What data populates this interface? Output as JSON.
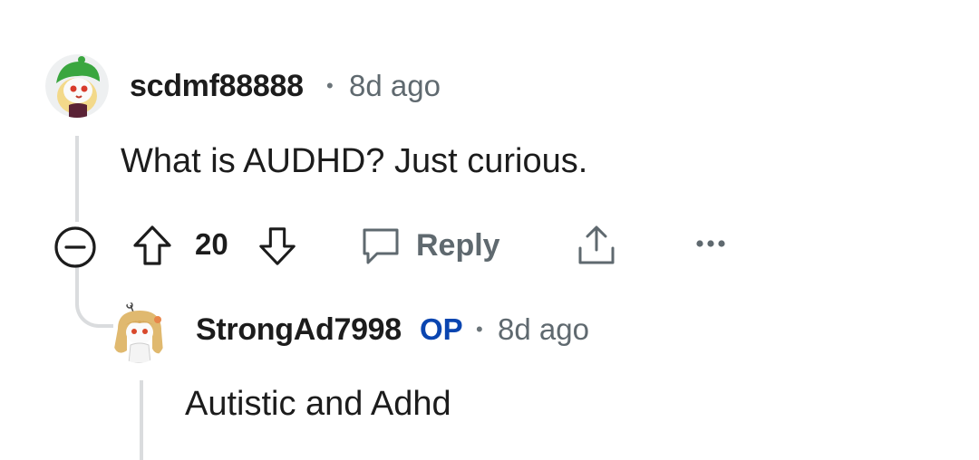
{
  "comment": {
    "username": "scdmf88888",
    "separator": "•",
    "time": "8d ago",
    "body": "What is AUDHD? Just curious.",
    "actions": {
      "score": "20",
      "reply_label": "Reply",
      "icons": [
        "collapse-icon",
        "upvote-icon",
        "downvote-icon",
        "reply-bubble-icon",
        "share-icon",
        "more-icon"
      ]
    }
  },
  "reply": {
    "username": "StrongAd7998",
    "op_badge": "OP",
    "separator": "•",
    "time": "8d ago",
    "body": "Autistic and Adhd"
  },
  "colors": {
    "op_badge": "#0a45b0",
    "meta_text": "#5f696f",
    "thread_line": "#dadcde",
    "avatar1_hat": "#3aa63f",
    "avatar1_face": "#f2f2f2",
    "avatar2_hair": "#e0b96f"
  }
}
